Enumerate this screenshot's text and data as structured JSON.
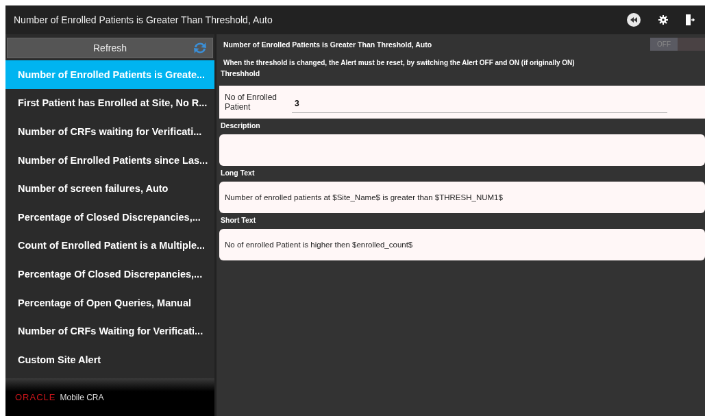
{
  "window": {
    "title": "Number of Enrolled Patients is Greater Than Threshold, Auto"
  },
  "sidebar": {
    "refresh_label": "Refresh",
    "items": [
      {
        "label": "Number of Enrolled Patients is Greate...",
        "selected": true
      },
      {
        "label": "First Patient has Enrolled at Site, No R...",
        "selected": false
      },
      {
        "label": "Number of CRFs waiting for Verificati...",
        "selected": false
      },
      {
        "label": "Number of Enrolled Patients since Las...",
        "selected": false
      },
      {
        "label": "Number of screen failures, Auto",
        "selected": false
      },
      {
        "label": "Percentage of Closed Discrepancies,...",
        "selected": false
      },
      {
        "label": "Count of Enrolled Patient is a Multiple...",
        "selected": false
      },
      {
        "label": "Percentage Of Closed Discrepancies,...",
        "selected": false
      },
      {
        "label": "Percentage of Open Queries, Manual",
        "selected": false
      },
      {
        "label": "Number of CRFs Waiting for Verificati...",
        "selected": false
      },
      {
        "label": "Custom Site Alert",
        "selected": false
      }
    ],
    "footer": {
      "brand": "ORACLE",
      "product": "Mobile CRA"
    }
  },
  "detail": {
    "title": "Number of Enrolled Patients is Greater Than Threshold, Auto",
    "toggle": {
      "label": "OFF",
      "on": false
    },
    "note": "When the threshold is changed, the Alert must be reset, by switching the Alert OFF and ON (if originally ON)",
    "threshold": {
      "heading": "Threshhold",
      "label": "No of Enrolled Patient",
      "value": "3"
    },
    "fields": [
      {
        "heading": "Description"
      },
      {
        "heading": "Long Text",
        "value": "Number of enrolled patients at $Site_Name$ is greater than $THRESH_NUM1$"
      },
      {
        "heading": "Short Text",
        "value": "No of enrolled Patient is higher then $enrolled_count$"
      }
    ]
  }
}
